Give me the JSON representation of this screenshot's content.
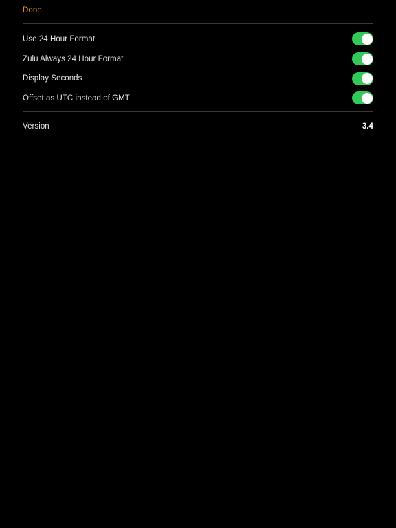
{
  "app": {
    "background_color": "#000000",
    "accent_color": "#E08A29",
    "switch_on_color": "#34C759",
    "divider_color": "#3A3A3C",
    "label_color": "#E6E6E6"
  },
  "navbar": {
    "done_label": "Done"
  },
  "settings": {
    "rows": [
      {
        "label": "Use 24 Hour Format",
        "switch_state": "on"
      },
      {
        "label": "Zulu Always 24 Hour Format",
        "switch_state": "on"
      },
      {
        "label": "Display Seconds",
        "switch_state": "on"
      },
      {
        "label": "Offset as UTC instead of GMT",
        "switch_state": "on"
      }
    ]
  },
  "version_row": {
    "label": "Version",
    "value": "3.4"
  }
}
